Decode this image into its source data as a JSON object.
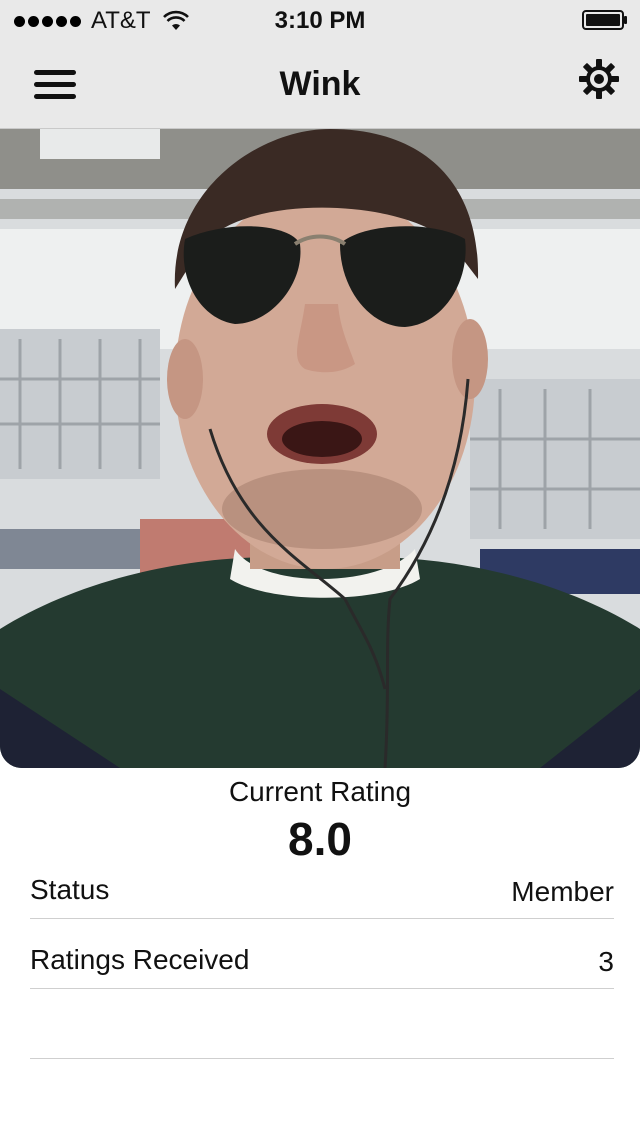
{
  "status_bar": {
    "carrier": "AT&T",
    "time": "3:10 PM"
  },
  "nav": {
    "title": "Wink",
    "menu_icon": "hamburger-menu-icon",
    "settings_icon": "gear-icon"
  },
  "profile": {
    "photo_icon": "profile-photo"
  },
  "rating": {
    "label": "Current Rating",
    "value": "8.0"
  },
  "details": [
    {
      "label": "Status",
      "value": "Member"
    },
    {
      "label": "Ratings Received",
      "value": "3"
    }
  ]
}
